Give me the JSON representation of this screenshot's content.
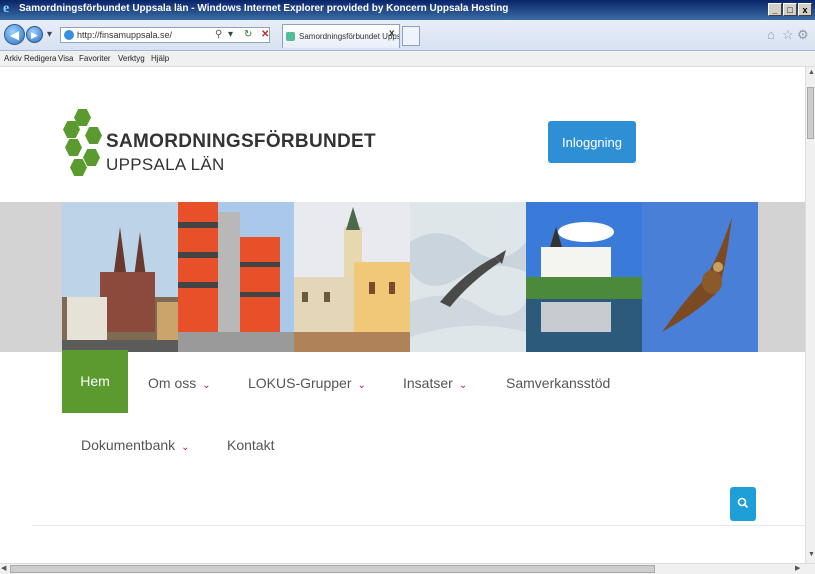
{
  "window": {
    "title": "Samordningsförbundet Uppsala län - Windows Internet Explorer provided by Koncern Uppsala Hosting",
    "buttons": [
      "_",
      "□",
      "x"
    ]
  },
  "browser": {
    "address": "http://finsamuppsala.se/",
    "tab_title": "Samordningsförbundet Upps...",
    "tab_close": "x",
    "menu": [
      "Arkiv",
      "Redigera",
      "Visa",
      "Favoriter",
      "Verktyg",
      "Hjälp"
    ],
    "icons": [
      "back-icon",
      "forward-icon",
      "search-icon",
      "refresh-icon",
      "stop-icon",
      "home-icon",
      "star-icon",
      "gear-icon"
    ]
  },
  "site": {
    "logo_line1": "SAMORDNINGSFÖRBUNDET",
    "logo_line2": "UPPSALA LÄN",
    "login_label": "Inloggning",
    "nav": [
      {
        "label": "Hem",
        "active": true,
        "dropdown": false
      },
      {
        "label": "Om oss",
        "active": false,
        "dropdown": true
      },
      {
        "label": "LOKUS-Grupper",
        "active": false,
        "dropdown": true
      },
      {
        "label": "Insatser",
        "active": false,
        "dropdown": true
      },
      {
        "label": "Samverkansstöd",
        "active": false,
        "dropdown": false
      },
      {
        "label": "Dokumentbank",
        "active": false,
        "dropdown": true
      },
      {
        "label": "Kontakt",
        "active": false,
        "dropdown": false
      }
    ],
    "chevron": "⌄",
    "search_icon": "search-icon"
  },
  "colors": {
    "brand_green": "#5a9a2e",
    "login_blue": "#2e8fd4",
    "search_blue": "#1e9fd8",
    "chevron_red": "#b02040"
  }
}
